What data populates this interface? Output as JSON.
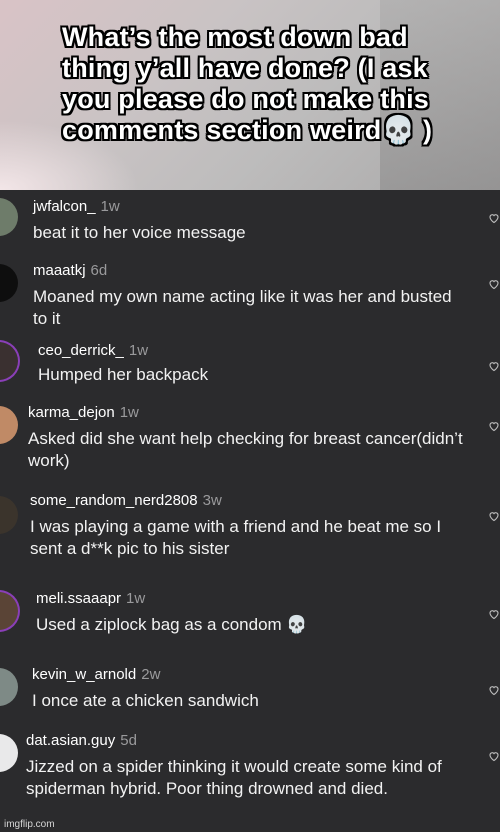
{
  "caption": "What’s the most down bad thing y’all have done? (I ask you please do not make this comments section weird💀 )",
  "comments": [
    {
      "user": "jwfalcon_",
      "time": "1w",
      "text": "beat it to her voice message"
    },
    {
      "user": "maaatkj",
      "time": "6d",
      "text": "Moaned my own name acting like it was her and busted to it"
    },
    {
      "user": "ceo_derrick_",
      "time": "1w",
      "text": "Humped her backpack"
    },
    {
      "user": "karma_dejon",
      "time": "1w",
      "text": "Asked did she want help checking for breast cancer(didn’t work)"
    },
    {
      "user": "some_random_nerd2808",
      "time": "3w",
      "text": "I was playing a game with a friend and he beat me so I sent a d**k pic to his sister"
    },
    {
      "user": "meli.ssaaapr",
      "time": "1w",
      "text": "Used a ziplock bag as a condom 💀"
    },
    {
      "user": "kevin_w_arnold",
      "time": "2w",
      "text": "I once ate a chicken sandwich"
    },
    {
      "user": "dat.asian.guy",
      "time": "5d",
      "text": "Jizzed on a spider thinking it would create some kind of spiderman hybrid. Poor thing drowned and died."
    }
  ],
  "icons": {
    "like": "heart-outline-icon"
  },
  "watermark": "imgflip.com"
}
